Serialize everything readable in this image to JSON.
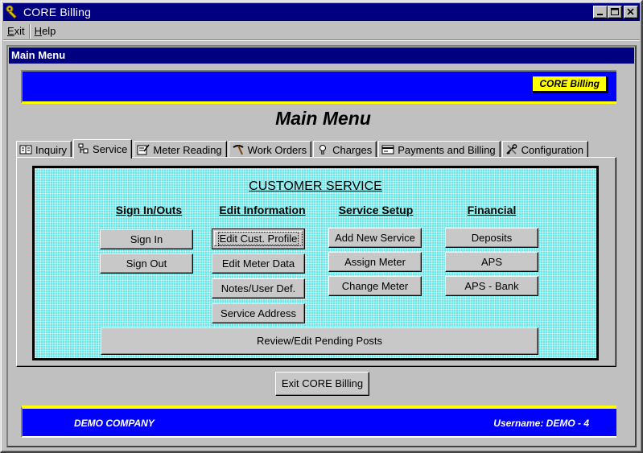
{
  "window": {
    "title": "CORE Billing"
  },
  "menubar": {
    "items": [
      {
        "label": "Exit",
        "accel": "E",
        "rest": "xit"
      },
      {
        "label": "Help",
        "accel": "H",
        "rest": "elp"
      }
    ]
  },
  "child_window": {
    "title": "Main Menu"
  },
  "banner": {
    "badge": "CORE Billing"
  },
  "page": {
    "title": "Main Menu"
  },
  "tabs": [
    {
      "label": "Inquiry",
      "icon": "book-icon",
      "active": false
    },
    {
      "label": "Service",
      "icon": "service-icon",
      "active": true
    },
    {
      "label": "Meter Reading",
      "icon": "notepad-icon",
      "active": false
    },
    {
      "label": "Work Orders",
      "icon": "pickaxe-icon",
      "active": false
    },
    {
      "label": "Charges",
      "icon": "lightbulb-icon",
      "active": false
    },
    {
      "label": "Payments and Billing",
      "icon": "card-icon",
      "active": false
    },
    {
      "label": "Configuration",
      "icon": "tools-icon",
      "active": false
    }
  ],
  "service": {
    "title": "CUSTOMER SERVICE",
    "columns": {
      "sign_in_outs": {
        "heading": "Sign In/Outs",
        "buttons": [
          "Sign In",
          "Sign Out"
        ]
      },
      "edit_information": {
        "heading": "Edit Information",
        "buttons": [
          "Edit Cust. Profile",
          "Edit Meter Data",
          "Notes/User Def.",
          "Service Address"
        ]
      },
      "service_setup": {
        "heading": "Service Setup",
        "buttons": [
          "Add New Service",
          "Assign Meter",
          "Change Meter"
        ]
      },
      "financial": {
        "heading": "Financial",
        "buttons": [
          "Deposits",
          "APS",
          "APS - Bank"
        ]
      }
    },
    "review_button": "Review/Edit Pending Posts"
  },
  "exit_button": "Exit CORE Billing",
  "footer": {
    "company": "DEMO COMPANY",
    "username": "Username: DEMO - 4"
  },
  "colors": {
    "titlebar": "#000080",
    "banner": "#0000ff",
    "accent": "#ffff00",
    "panel": "#5fe3e3"
  }
}
